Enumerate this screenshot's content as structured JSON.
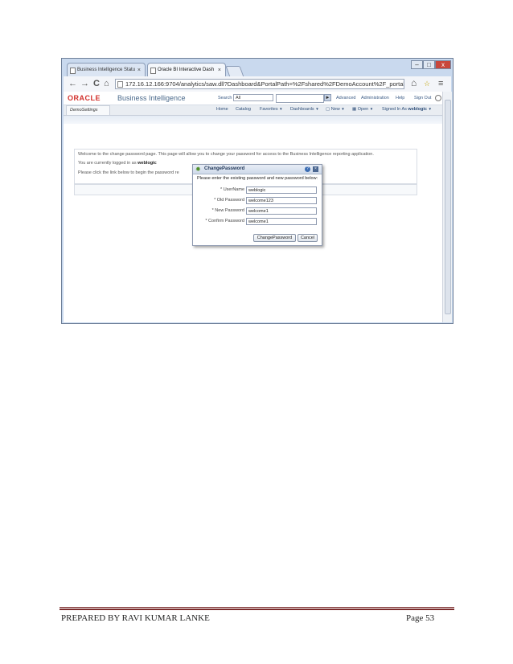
{
  "browser": {
    "tabs": [
      {
        "label": "Business Intelligence Statu",
        "close": "×"
      },
      {
        "label": "Oracle BI Interactive Dash",
        "close": "×"
      }
    ],
    "window_controls": {
      "minimize": "–",
      "maximize": "□",
      "close": "x"
    },
    "nav": {
      "back": "←",
      "forward": "→",
      "reload": "C",
      "home": "⌂"
    },
    "url": "172.16.12.166:9704/analytics/saw.dll?Dashboard&PortalPath=%2Fshared%2FDemoAccount%2F_portal%2FDe",
    "menu_icon": "≡"
  },
  "obiee": {
    "logo": "ORACLE",
    "product": "Business Intelligence",
    "search_label": "Search",
    "search_scope": "All",
    "advanced": "Advanced",
    "administration": "Administration",
    "help": "Help",
    "sign_out": "Sign Out",
    "page_tab": "DemoSettings",
    "nav": {
      "home": "Home",
      "catalog": "Catalog",
      "favorites": "Favorites",
      "dashboards": "Dashboards",
      "new": "New",
      "open": "Open",
      "signed_in_as": "Signed In As",
      "user": "weblogic"
    },
    "page_text": {
      "welcome": "Welcome to the change password page. This page will allow you to change your password for access to the Business Intelligence reporting application.",
      "logged_in_prefix": "You are currently logged in as ",
      "logged_in_user": "weblogic",
      "click_link": "Please click the link below to begin the password re"
    }
  },
  "dialog": {
    "title": "ChangePassword",
    "instruction": "Please enter the existing password and new password below:",
    "fields": {
      "username": {
        "label": "* UserName",
        "value": "weblogic"
      },
      "old": {
        "label": "* Old Password",
        "value": "welcome123"
      },
      "new": {
        "label": "* New Password",
        "value": "welcome1"
      },
      "confirm": {
        "label": "* Confirm Password",
        "value": "welcome1"
      }
    },
    "change_button": "ChangePassword",
    "cancel_button": "Cancel"
  },
  "footer": {
    "left": "PREPARED BY RAVI KUMAR LANKE",
    "right": "Page 53"
  }
}
